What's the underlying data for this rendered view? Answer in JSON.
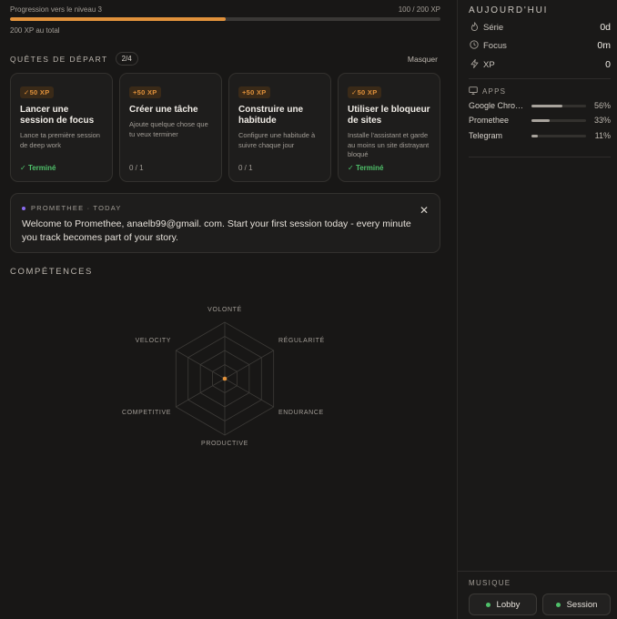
{
  "progress": {
    "label": "Progression vers le niveau 3",
    "value_text": "100 / 200 XP",
    "fraction": 0.5,
    "total": "200 XP au total"
  },
  "quests": {
    "title": "QUÊTES DE DÉPART",
    "count": "2/4",
    "hide_label": "Masquer",
    "items": [
      {
        "badge": "✓50 XP",
        "title": "Lancer une session de focus",
        "desc": "Lance ta première session de deep work",
        "footer": "Terminé",
        "done": true
      },
      {
        "badge": "+50 XP",
        "title": "Créer une tâche",
        "desc": "Ajoute quelque chose que tu veux terminer",
        "footer": "0 / 1",
        "done": false
      },
      {
        "badge": "+50 XP",
        "title": "Construire une habitude",
        "desc": "Configure une habitude à suivre chaque jour",
        "footer": "0 / 1",
        "done": false
      },
      {
        "badge": "✓50 XP",
        "title": "Utiliser le bloqueur de sites",
        "desc": "Installe l'assistant et garde au moins un site distrayant bloqué",
        "footer": "Terminé",
        "done": true
      }
    ]
  },
  "welcome": {
    "header": "PROMETHEE · TODAY",
    "text": "Welcome to Promethee, anaelb99@gmail. com. Start your first session today - every minute you track becomes part of your story."
  },
  "skills": {
    "title": "COMPÉTENCES",
    "axes": [
      "VOLONTÉ",
      "RÉGULARITÉ",
      "ENDURANCE",
      "PRODUCTIVE",
      "COMPETITIVE",
      "VELOCITY"
    ]
  },
  "sidebar": {
    "today_title": "AUJOURD'HUI",
    "stats": [
      {
        "icon": "flame-icon",
        "label": "Série",
        "value": "0d"
      },
      {
        "icon": "clock-icon",
        "label": "Focus",
        "value": "0m"
      },
      {
        "icon": "bolt-icon",
        "label": "XP",
        "value": "0"
      }
    ],
    "apps_title": "APPS",
    "apps": [
      {
        "name": "Google Chrome",
        "pct": "56%",
        "fraction": 0.56
      },
      {
        "name": "Promethee",
        "pct": "33%",
        "fraction": 0.33
      },
      {
        "name": "Telegram",
        "pct": "11%",
        "fraction": 0.11
      }
    ],
    "music_title": "MUSIQUE",
    "music_buttons": [
      "Lobby",
      "Session"
    ]
  },
  "colors": {
    "accent": "#e0913b",
    "success": "#4fc06a",
    "purple": "#8a6cf0"
  }
}
